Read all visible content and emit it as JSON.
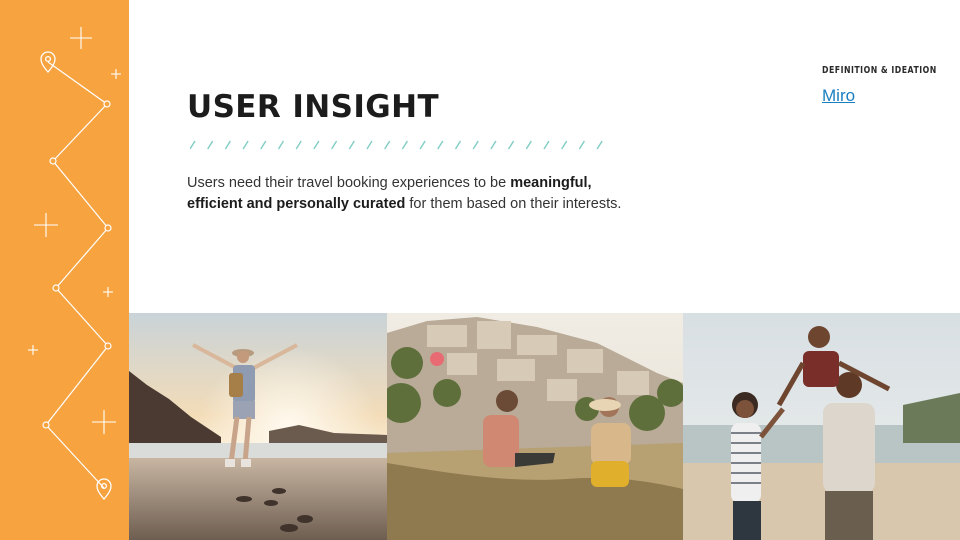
{
  "header": {
    "section_tag": "DEFINITION & IDEATION",
    "link_label": "Miro"
  },
  "main": {
    "title": "USER INSIGHT",
    "body_parts": [
      "Users need their travel booking experiences to be ",
      "meaningful,",
      "efficient and personally curated",
      " for them based on their interests."
    ]
  },
  "colors": {
    "sidebar": "#f6a340",
    "accent_dashes": "#7fcdc4",
    "link": "#1a7fc1"
  },
  "icons": [
    "location-pin-icon",
    "sparkle-icon"
  ]
}
